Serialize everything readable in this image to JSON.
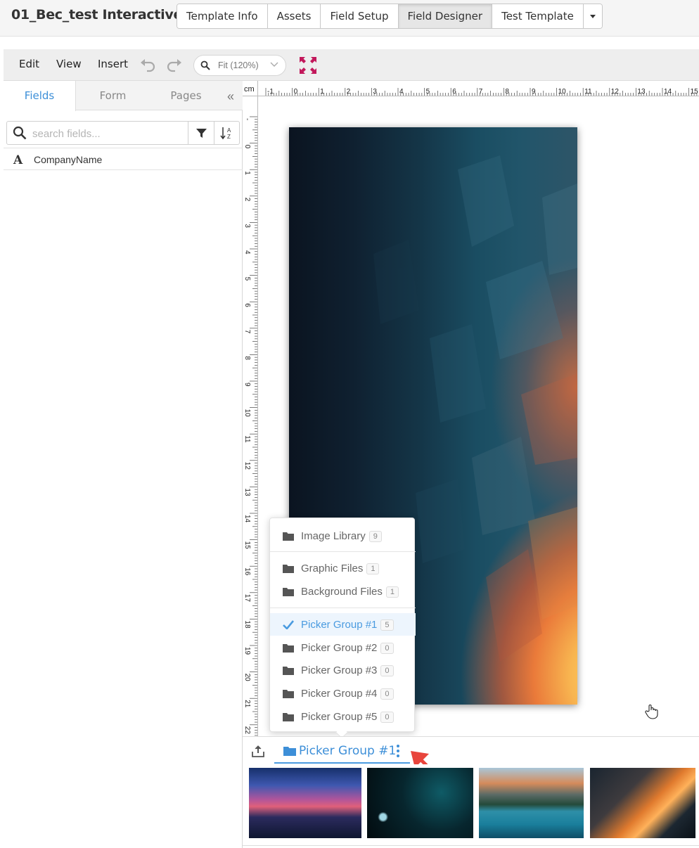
{
  "app": {
    "title": "01_Bec_test Interactive"
  },
  "tabs": [
    {
      "label": "Template Info",
      "active": false
    },
    {
      "label": "Assets",
      "active": false
    },
    {
      "label": "Field Setup",
      "active": false
    },
    {
      "label": "Field Designer",
      "active": true
    },
    {
      "label": "Test Template",
      "active": false
    }
  ],
  "toolbar": {
    "menus": [
      "Edit",
      "View",
      "Insert"
    ],
    "zoom_label": "Fit (120%)",
    "icons": [
      "undo-icon",
      "redo-icon",
      "search-icon",
      "chevron-down-icon",
      "expand-icon"
    ]
  },
  "left_panel": {
    "tabs": [
      {
        "label": "Fields",
        "active": true
      },
      {
        "label": "Form",
        "active": false
      },
      {
        "label": "Pages",
        "active": false
      }
    ],
    "search_placeholder": "search fields...",
    "fields": [
      {
        "icon": "text-icon",
        "icon_glyph": "A",
        "name": "CompanyName"
      }
    ]
  },
  "ruler": {
    "unit": "cm",
    "top_labels": [
      "-1",
      "0",
      "1",
      "2",
      "3",
      "4",
      "5",
      "6",
      "7",
      "8",
      "9",
      "10",
      "11",
      "12",
      "13",
      "14",
      "15"
    ],
    "left_labels": [
      "-",
      "0",
      "1",
      "2",
      "3",
      "4",
      "5",
      "6",
      "7",
      "8",
      "9",
      "10",
      "11",
      "12",
      "13",
      "14",
      "15",
      "16",
      "17",
      "18",
      "19",
      "20",
      "21",
      "22"
    ]
  },
  "dropdown": {
    "items": [
      {
        "label": "Image Library",
        "count": "9",
        "selected": false
      },
      {
        "label": "Graphic Files",
        "count": "1",
        "selected": false
      },
      {
        "label": "Background Files",
        "count": "1",
        "selected": false
      },
      {
        "label": "Picker Group #1",
        "count": "5",
        "selected": true
      },
      {
        "label": "Picker Group #2",
        "count": "0",
        "selected": false
      },
      {
        "label": "Picker Group #3",
        "count": "0",
        "selected": false
      },
      {
        "label": "Picker Group #4",
        "count": "0",
        "selected": false
      },
      {
        "label": "Picker Group #5",
        "count": "0",
        "selected": false
      }
    ]
  },
  "image_panel": {
    "active_group": "Picker Group #1",
    "thumbnails": [
      "city-sunset-thumbnail",
      "night-city-thumbnail",
      "mountain-lake-thumbnail",
      "skyscrapers-thumbnail"
    ]
  },
  "colors": {
    "accent": "#3d8fd8",
    "selected_bg": "#edf5fd",
    "arrow": "#e8453c",
    "expand_icon": "#c2185b"
  }
}
